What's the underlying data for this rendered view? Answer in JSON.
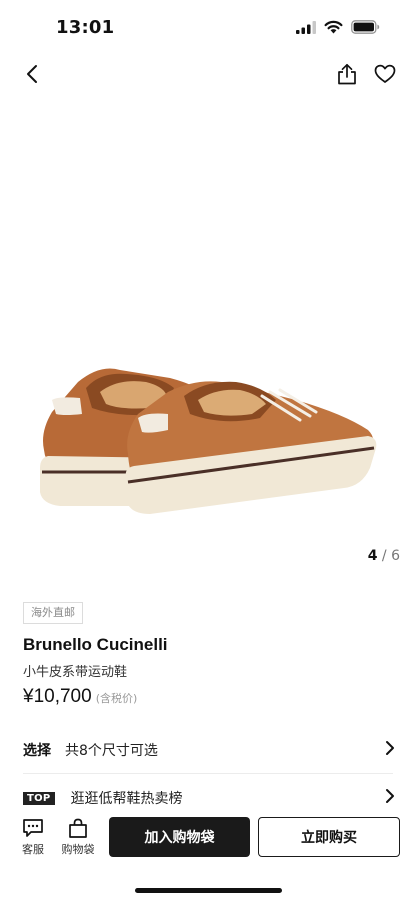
{
  "status_bar": {
    "time": "13:01"
  },
  "nav": {
    "back_icon": "chevron-left-icon",
    "share_icon": "share-icon",
    "favorite_icon": "heart-icon"
  },
  "gallery": {
    "current": "4",
    "separator": "/",
    "total": "6"
  },
  "product": {
    "tag": "海外直邮",
    "brand": "Brunello Cucinelli",
    "name": "小牛皮系带运动鞋",
    "price": "¥10,700",
    "tax_note": "(含税价)"
  },
  "rows": {
    "select_label": "选择",
    "select_text": "共8个尺寸可选",
    "top_badge": "TOP",
    "top_text": "逛逛低帮鞋热卖榜"
  },
  "bottom_bar": {
    "customer_service": "客服",
    "shopping_bag": "购物袋",
    "add_to_bag": "加入购物袋",
    "buy_now": "立即购买"
  },
  "colors": {
    "leather": "#b86a37",
    "sole": "#f1e8d6",
    "stripe": "#4a2f27",
    "dark_button": "#1a1a1a"
  }
}
